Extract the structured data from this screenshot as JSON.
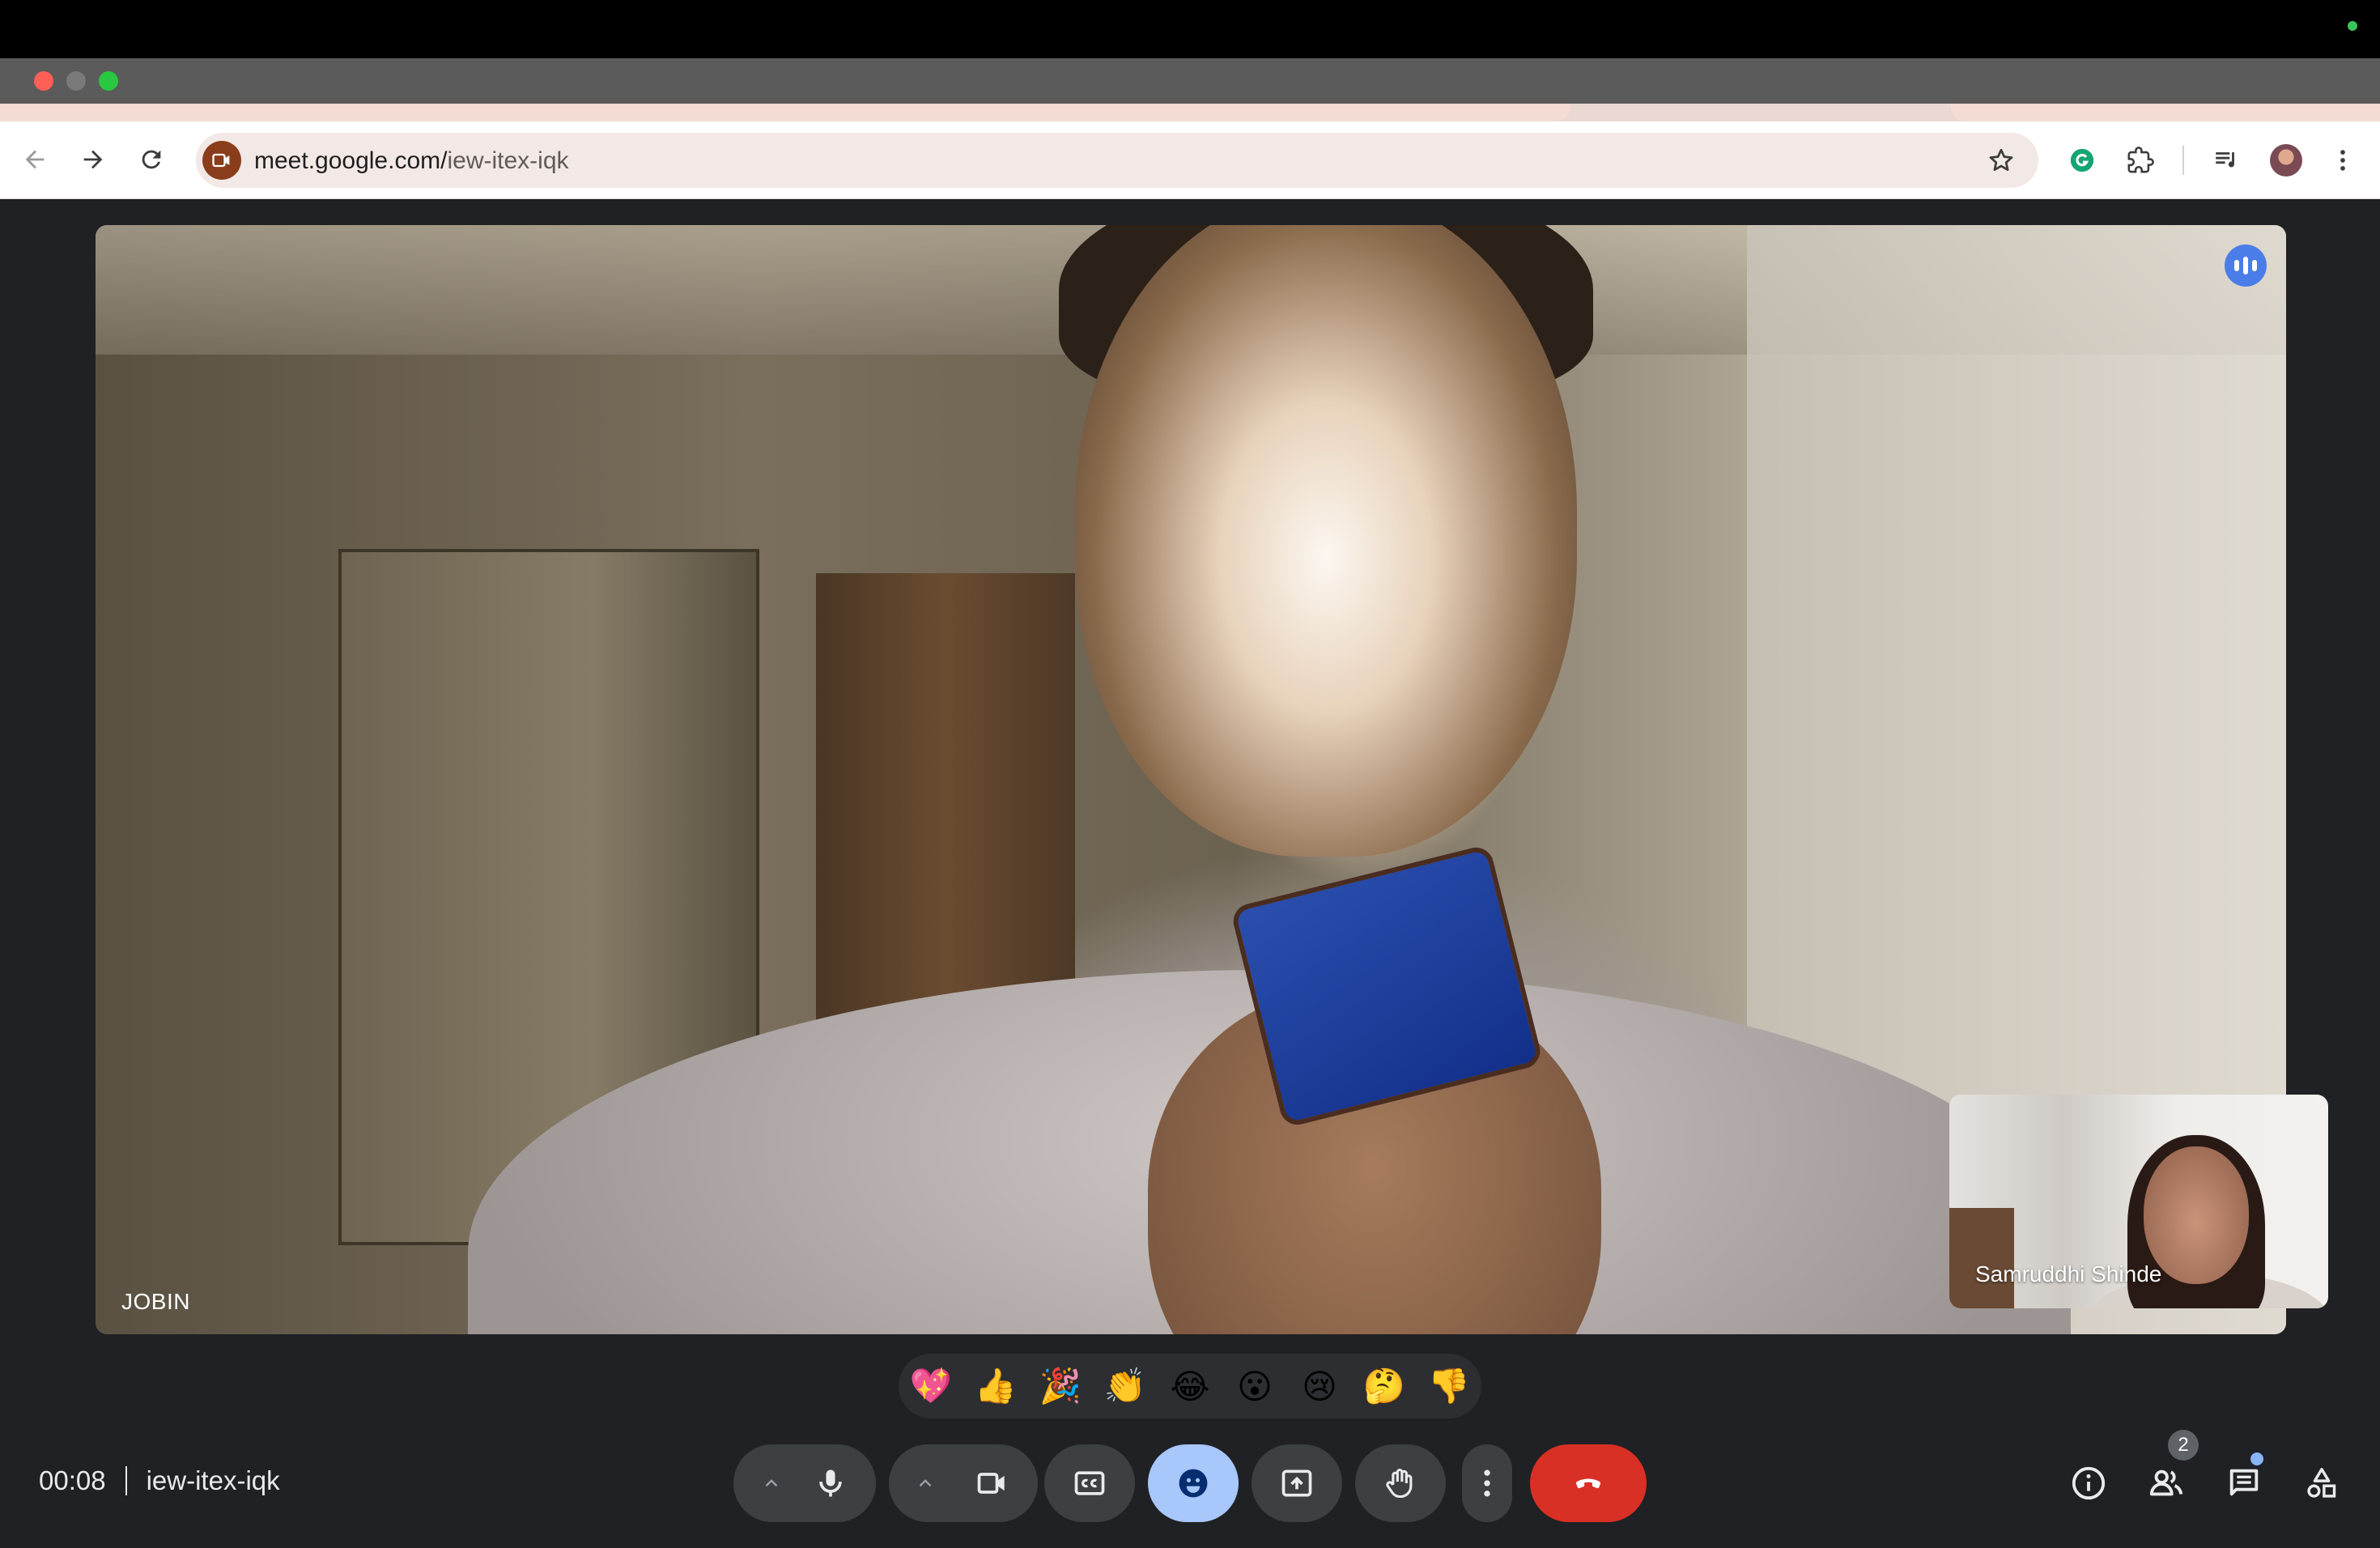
{
  "browser": {
    "url_host": "meet.google.com/",
    "url_path": "iew-itex-iqk"
  },
  "meeting": {
    "elapsed": "00:08",
    "code": "iew-itex-iqk",
    "main_participant": "JOBIN",
    "self_participant": "Samruddhi Shinde",
    "participant_count": "2"
  },
  "reactions": [
    "💖",
    "👍",
    "🎉",
    "👏",
    "😂",
    "😮",
    "😢",
    "🤔",
    "👎"
  ],
  "icons": {
    "toolbar": [
      "back-icon",
      "forward-icon",
      "reload-icon",
      "meet-site-icon",
      "star-icon",
      "grammarly-icon",
      "extensions-icon",
      "media-controls-icon",
      "profile-avatar",
      "menu-icon"
    ],
    "controls": [
      "audio-options-caret",
      "microphone-icon",
      "video-options-caret",
      "camera-icon",
      "captions-icon",
      "emoji-icon",
      "present-icon",
      "raise-hand-icon",
      "more-options-icon",
      "end-call-icon"
    ],
    "side": [
      "info-icon",
      "people-icon",
      "chat-icon",
      "activities-icon"
    ]
  },
  "colors": {
    "meet_background": "#202124",
    "control_bg": "#3c4043",
    "reactions_active": "#a8c7fa",
    "end_call": "#d93025",
    "speaking_indicator": "#4a7de8"
  }
}
